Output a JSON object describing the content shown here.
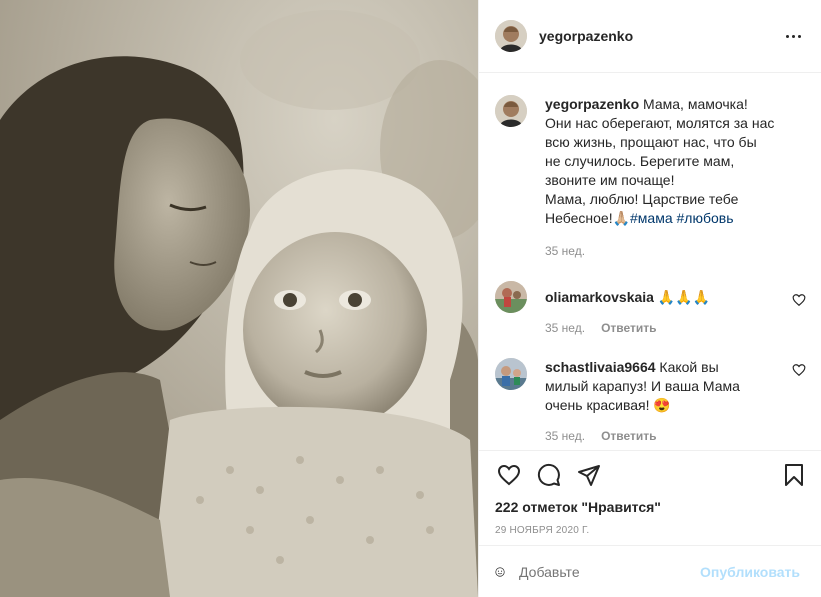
{
  "post": {
    "author": "yegorpazenko",
    "caption": {
      "username": "yegorpazenko",
      "lines": [
        "Мама, мамочка!",
        "Они нас оберегают, молятся за нас",
        "всю жизнь, прощают нас, что бы",
        "не случилось. Берегите мам,",
        "звоните им почаще!",
        "Мама, люблю! Царствие тебе"
      ],
      "last_line_text": "Небесное!🙏🏼",
      "hashtags": [
        "#мама",
        "#любовь"
      ],
      "time": "35 нед."
    },
    "comments": [
      {
        "username": "oliamarkovskaia",
        "text": "🙏🙏🙏",
        "time": "35 нед.",
        "reply_label": "Ответить"
      },
      {
        "username": "schastlivaia9664",
        "text_lines": [
          "Какой вы",
          "милый карапуз! И ваша Мама",
          "очень красивая! 😍"
        ],
        "time": "35 нед.",
        "reply_label": "Ответить"
      }
    ],
    "likes_label": "222 отметок \"Нравится\"",
    "date": "29 ноября 2020 г.",
    "add_comment_placeholder": "Добавьте",
    "publish_label": "Опубликовать",
    "icons": {
      "more": "more-options-icon",
      "like": "heart-icon",
      "comment": "comment-icon",
      "share": "share-icon",
      "save": "bookmark-icon",
      "emoji": "emoji-icon",
      "comment_like": "heart-icon"
    },
    "colors": {
      "text": "#262626",
      "muted": "#8e8e8e",
      "hashtag": "#00376b",
      "publish_disabled": "#b2dffc",
      "border": "#efefef"
    }
  }
}
